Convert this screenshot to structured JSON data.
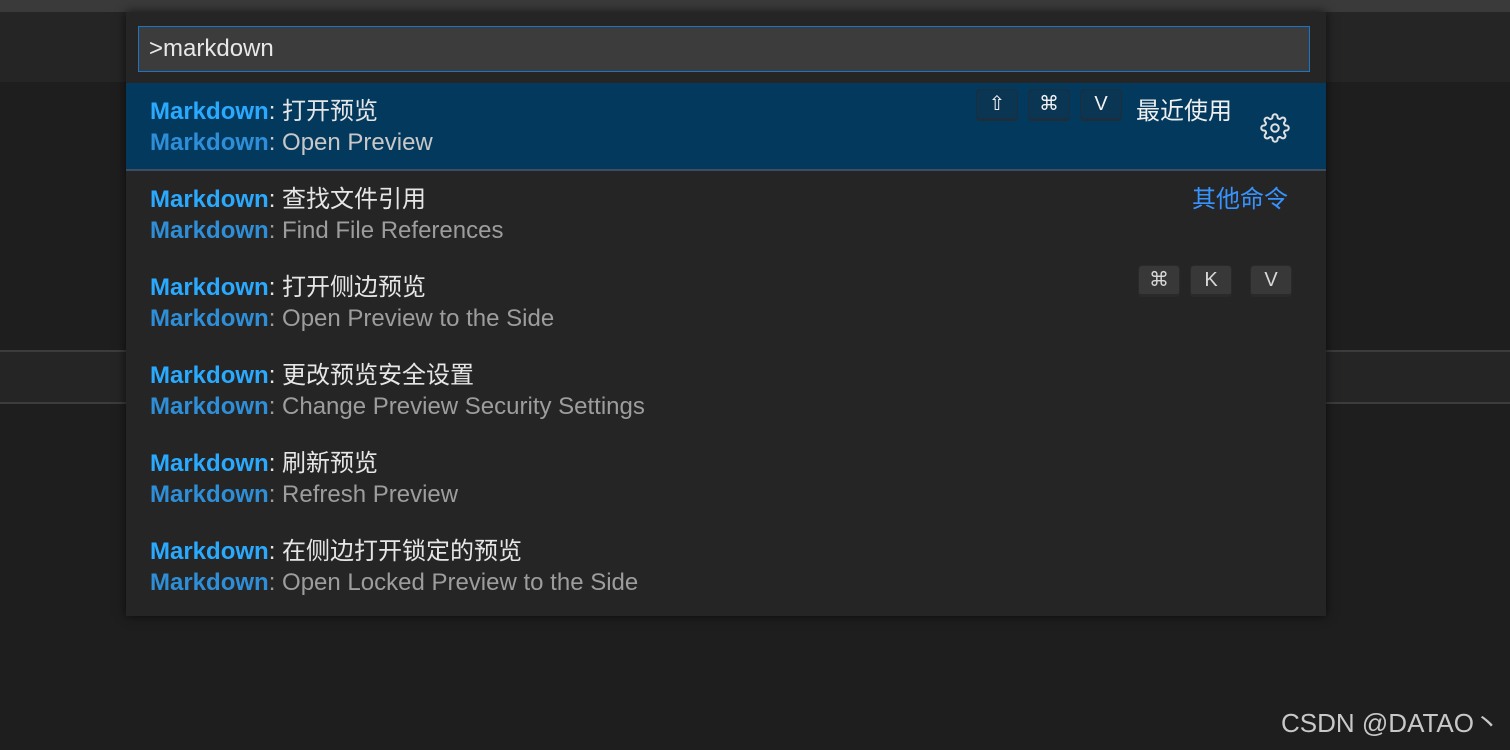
{
  "search": {
    "value": ">markdown"
  },
  "items": [
    {
      "prefix": "Markdown",
      "label_zh": ": 打开预览",
      "label_en": ": Open Preview",
      "keys": [
        "⇧",
        "⌘",
        "V"
      ],
      "group_label": "最近使用",
      "gear_icon": "gear-icon"
    },
    {
      "prefix": "Markdown",
      "label_zh": ": 查找文件引用",
      "label_en": ": Find File References",
      "group_label": "其他命令"
    },
    {
      "prefix": "Markdown",
      "label_zh": ": 打开侧边预览",
      "label_en": ": Open Preview to the Side",
      "keys": [
        "⌘",
        "K",
        "V"
      ]
    },
    {
      "prefix": "Markdown",
      "label_zh": ": 更改预览安全设置",
      "label_en": ": Change Preview Security Settings"
    },
    {
      "prefix": "Markdown",
      "label_zh": ": 刷新预览",
      "label_en": ": Refresh Preview"
    },
    {
      "prefix": "Markdown",
      "label_zh": ": 在侧边打开锁定的预览",
      "label_en": ": Open Locked Preview to the Side"
    }
  ],
  "watermark": "CSDN @DATAO丶",
  "colors": {
    "accent_highlight": "#2aaaff",
    "selection_bg": "#04395e",
    "focus_border": "#1b74c6",
    "link": "#3794ff"
  }
}
